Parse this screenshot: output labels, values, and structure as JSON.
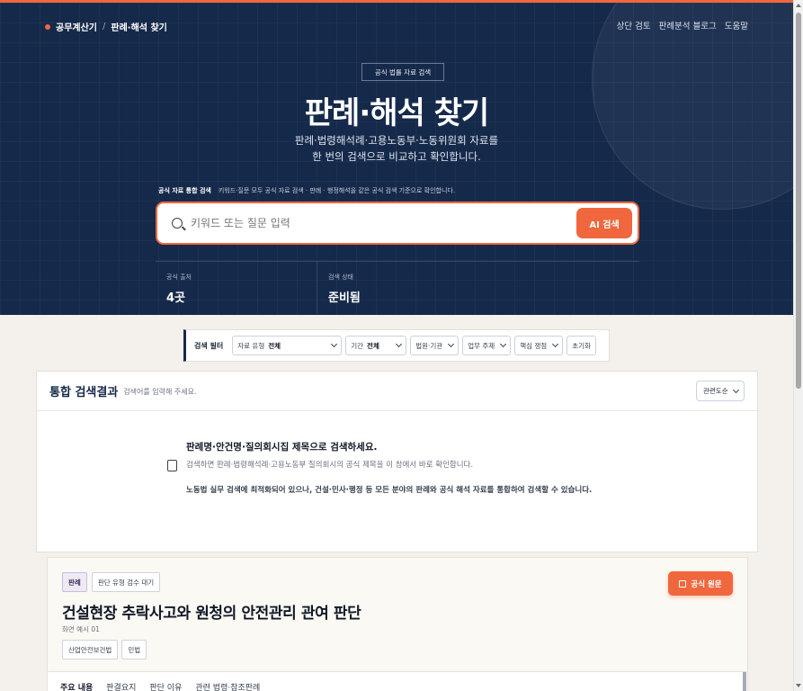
{
  "breadcrumb": {
    "home": "공무계산기",
    "separator": "/",
    "current": "판례·해석 찾기"
  },
  "topnav": [
    "상단 검토",
    "판례분석 블로그",
    "도움말"
  ],
  "hero": {
    "badge": "공식 법률 자료 검색",
    "title": "판례·해석 찾기",
    "subtitle_line1": "판례·법령해석례·고용노동부·노동위원회 자료를",
    "subtitle_line2": "한 번의 검색으로 비교하고 확인합니다."
  },
  "search": {
    "note_label": "공식 자료 통합 검색",
    "note_text": "키워드·질문 모두 공식 자료 검색 · 판례 · 행정해석을 같은 공식 검색 기준으로 확인합니다.",
    "placeholder": "키워드 또는 질문 입력",
    "button": "AI 검색"
  },
  "stats": [
    {
      "label": "공식 출처",
      "value": "4곳"
    },
    {
      "label": "검색 상태",
      "value": "준비됨"
    }
  ],
  "filters": {
    "label": "검색 필터",
    "type_label": "자료 유형",
    "type_value": "전체",
    "period_label": "기간",
    "period_value": "전체",
    "court": "법원·기관",
    "topic": "업무 주제",
    "issue": "핵심 쟁점",
    "reset": "초기화"
  },
  "results": {
    "title": "통합 검색결과",
    "hint": "검색어를 입력해 주세요.",
    "sort": "관련도순",
    "empty_title": "판례명·안건명·질의회시집 제목으로 검색하세요.",
    "empty_desc": "검색하면 판례·법령해석례·고용노동부 질의회시의 공식 제목을 이 창에서 바로 확인합니다.",
    "empty_note": "노동법 실무 검색에 최적화되어 있으나, 건설·민사·행정 등 모든 분야의 판례와 공식 해석 자료를 통합하여 검색할 수 있습니다."
  },
  "card": {
    "tag_kind": "판례",
    "tag_status": "판단 유형 검수 대기",
    "title": "건설현장 추락사고와 원청의 안전관리 관여 판단",
    "subtitle": "화면 예시 01",
    "laws": [
      "산업안전보건법",
      "민법"
    ],
    "original_button": "공식 원문",
    "tabs": [
      "주요 내용",
      "판결요지",
      "판단 이유",
      "관련 법령·참조판례"
    ]
  },
  "colors": {
    "navy": "#15294a",
    "accent": "#f0673e",
    "background": "#f4f1ec"
  }
}
